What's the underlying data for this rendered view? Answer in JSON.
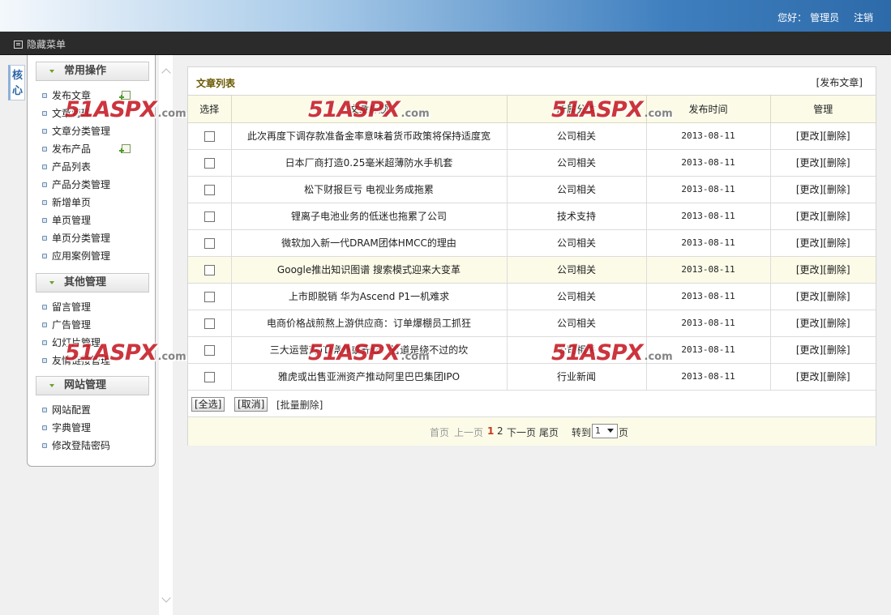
{
  "header": {
    "greeting": "您好：",
    "user": "管理员",
    "logout": "注销"
  },
  "toolbar": {
    "hide_menu": "隐藏菜单"
  },
  "left_tab": {
    "label_1": "核",
    "label_2": "心"
  },
  "sidebar": {
    "groups": [
      {
        "title": "常用操作",
        "items": [
          "发布文章",
          "文章管理",
          "文章分类管理",
          "发布产品",
          "产品列表",
          "产品分类管理",
          "新增单页",
          "单页管理",
          "单页分类管理",
          "应用案例管理"
        ]
      },
      {
        "title": "其他管理",
        "items": [
          "留言管理",
          "广告管理",
          "幻灯片管理",
          "友情链接管理"
        ]
      },
      {
        "title": "网站管理",
        "items": [
          "网站配置",
          "字典管理",
          "修改登陆密码"
        ]
      }
    ]
  },
  "panel": {
    "title": "文章列表",
    "publish": "[发布文章]",
    "columns": [
      "选择",
      "文章标题",
      "所属分类",
      "发布时间",
      "管理"
    ],
    "edit": "[更改]",
    "delete": "[删除]",
    "rows": [
      {
        "title": "此次再度下调存款准备金率意味着货币政策将保持适度宽",
        "category": "公司相关",
        "date": "2013-08-11"
      },
      {
        "title": "日本厂商打造0.25毫米超薄防水手机套",
        "category": "公司相关",
        "date": "2013-08-11"
      },
      {
        "title": "松下财报巨亏 电视业务成拖累",
        "category": "公司相关",
        "date": "2013-08-11"
      },
      {
        "title": "锂离子电池业务的低迷也拖累了公司",
        "category": "技术支持",
        "date": "2013-08-11"
      },
      {
        "title": "微软加入新一代DRAM团体HMCC的理由",
        "category": "公司相关",
        "date": "2013-08-11"
      },
      {
        "title": "Google推出知识图谱 搜索模式迎来大变革",
        "category": "公司相关",
        "date": "2013-08-11"
      },
      {
        "title": "上市即脱销 华为Ascend P1一机难求",
        "category": "公司相关",
        "date": "2013-08-11"
      },
      {
        "title": "电商价格战煎熬上游供应商：订单爆棚员工抓狂",
        "category": "公司相关",
        "date": "2013-08-11"
      },
      {
        "title": "三大运营商TD竞争或升级：管道是绕不过的坎",
        "category": "公司相关",
        "date": "2013-08-11"
      },
      {
        "title": "雅虎或出售亚洲资产推动阿里巴巴集团IPO",
        "category": "行业新闻",
        "date": "2013-08-11"
      }
    ],
    "select_all": "[全选]",
    "cancel": "[取消]",
    "batch_delete": "[批量删除]"
  },
  "pager": {
    "first": "首页",
    "prev": "上一页",
    "page1": "1",
    "page2": "2",
    "next": "下一页",
    "last": "尾页",
    "goto": "转到",
    "selected": "1",
    "page_unit": "页"
  },
  "watermark": {
    "prefix": "51",
    "brand": "ASPX",
    "suffix": ".com"
  }
}
